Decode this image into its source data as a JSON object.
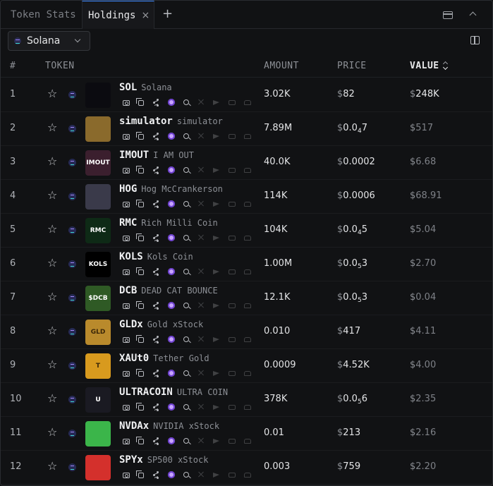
{
  "tabs": [
    {
      "label": "Token Stats",
      "active": false
    },
    {
      "label": "Holdings",
      "active": true,
      "close": "×"
    }
  ],
  "add_tab": "+",
  "chain_selector": {
    "value": "Solana"
  },
  "table": {
    "headers": {
      "num": "#",
      "token": "TOKEN",
      "amount": "AMOUNT",
      "price": "PRICE",
      "value": "VALUE"
    },
    "sorted_by": "value",
    "rows": [
      {
        "num": "1",
        "symbol": "SOL",
        "name": "Solana",
        "amount": "3.02K",
        "price": "82",
        "value": "248K",
        "logo_color": "#0b0b10",
        "logo_text": "",
        "value_highlight": true
      },
      {
        "num": "2",
        "symbol": "simulator",
        "name": "simulator",
        "amount": "7.89M",
        "price_parts": [
          "0.0",
          "4",
          "7"
        ],
        "value": "517",
        "logo_color": "#8a6a2c",
        "logo_text": ""
      },
      {
        "num": "3",
        "symbol": "IMOUT",
        "name": "I AM OUT",
        "amount": "40.0K",
        "price": "0.0002",
        "value": "6.68",
        "logo_color": "#3b1f2e",
        "logo_text": "IMOUT"
      },
      {
        "num": "4",
        "symbol": "HOG",
        "name": "Hog McCrankerson",
        "amount": "114K",
        "price": "0.0006",
        "value": "68.91",
        "logo_color": "#3a3a4a",
        "logo_text": ""
      },
      {
        "num": "5",
        "symbol": "RMC",
        "name": "Rich Milli Coin",
        "amount": "104K",
        "price_parts": [
          "0.0",
          "4",
          "5"
        ],
        "value": "5.04",
        "logo_color": "#0e2a16",
        "logo_text": "RMC"
      },
      {
        "num": "6",
        "symbol": "KOLS",
        "name": "Kols Coin",
        "amount": "1.00M",
        "price_parts": [
          "0.0",
          "5",
          "3"
        ],
        "value": "2.70",
        "logo_color": "#000000",
        "logo_text": "KOLS"
      },
      {
        "num": "7",
        "symbol": "DCB",
        "name": "DEAD CAT BOUNCE",
        "amount": "12.1K",
        "price_parts": [
          "0.0",
          "5",
          "3"
        ],
        "value": "0.04",
        "logo_color": "#2f5a25",
        "logo_text": "$DCB"
      },
      {
        "num": "8",
        "symbol": "GLDx",
        "name": "Gold xStock",
        "amount": "0.010",
        "price": "417",
        "value": "4.11",
        "logo_color": "#b98a2c",
        "logo_text": "GLD"
      },
      {
        "num": "9",
        "symbol": "XAUt0",
        "name": "Tether Gold",
        "amount": "0.0009",
        "price": "4.52K",
        "value": "4.00",
        "logo_color": "#d89a1e",
        "logo_text": "T"
      },
      {
        "num": "10",
        "symbol": "ULTRACOIN",
        "name": "ULTRA COIN",
        "amount": "378K",
        "price_parts": [
          "0.0",
          "5",
          "6"
        ],
        "value": "2.35",
        "logo_color": "#1a1a22",
        "logo_text": "U"
      },
      {
        "num": "11",
        "symbol": "NVDAx",
        "name": "NVIDIA xStock",
        "amount": "0.01",
        "price": "213",
        "value": "2.16",
        "logo_color": "#3bb54a",
        "logo_text": ""
      },
      {
        "num": "12",
        "symbol": "SPYx",
        "name": "SP500 xStock",
        "amount": "0.003",
        "price": "759",
        "value": "2.20",
        "logo_color": "#d4302c",
        "logo_text": ""
      }
    ]
  }
}
